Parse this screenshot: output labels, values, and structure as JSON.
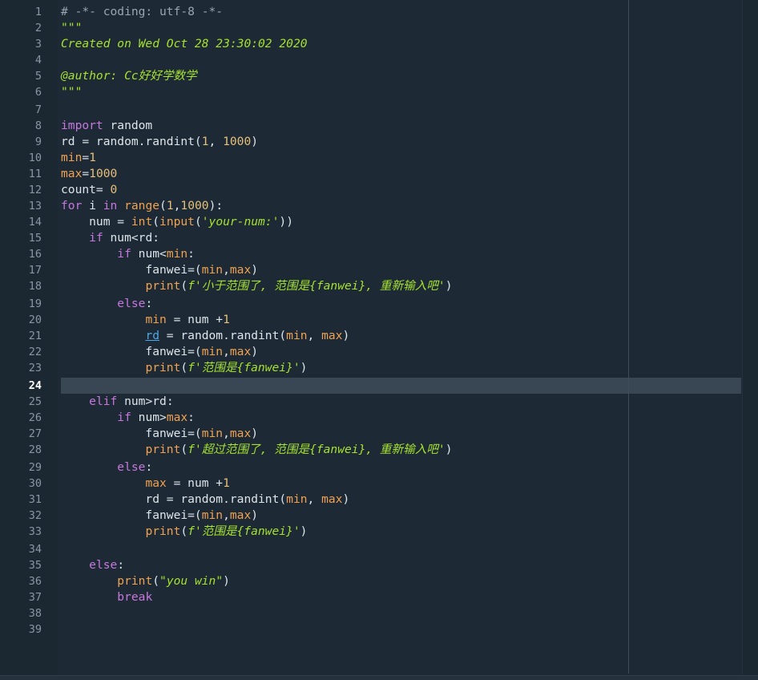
{
  "editor": {
    "active_line": 24,
    "line_numbers": [
      "1",
      "2",
      "3",
      "4",
      "5",
      "6",
      "7",
      "8",
      "9",
      "10",
      "11",
      "12",
      "13",
      "14",
      "15",
      "16",
      "17",
      "18",
      "19",
      "20",
      "21",
      "22",
      "23",
      "24",
      "25",
      "26",
      "27",
      "28",
      "29",
      "30",
      "31",
      "32",
      "33",
      "34",
      "35",
      "36",
      "37",
      "38",
      "39"
    ],
    "colors": {
      "background": "#1d2935",
      "gutter": "#1b2731",
      "current_line": "#384753",
      "keyword": "#c678dd",
      "number": "#e5c07b",
      "builtin": "#f0a250",
      "string": "#a6e22e",
      "comment": "#9aa5b0",
      "text": "#dde4ea",
      "link": "#4ea9e9"
    },
    "lines": {
      "l1": [
        {
          "t": "# -*- coding: utf-8 -*-",
          "c": "cmt"
        }
      ],
      "l2": [
        {
          "t": "\"\"\"",
          "c": "doc"
        }
      ],
      "l3": [
        {
          "t": "Created on Wed Oct 28 23:30:02 2020",
          "c": "doc"
        }
      ],
      "l4": [],
      "l5": [
        {
          "t": "@author: Cc好好学数学",
          "c": "doc"
        }
      ],
      "l6": [
        {
          "t": "\"\"\"",
          "c": "doc"
        }
      ],
      "l7": [],
      "l8": [
        {
          "t": "import",
          "c": "kw"
        },
        {
          "t": " random",
          "c": "plain"
        }
      ],
      "l9": [
        {
          "t": "rd = random.randint(",
          "c": "plain"
        },
        {
          "t": "1",
          "c": "num"
        },
        {
          "t": ", ",
          "c": "plain"
        },
        {
          "t": "1000",
          "c": "num"
        },
        {
          "t": ")",
          "c": "plain"
        }
      ],
      "l10": [
        {
          "t": "min",
          "c": "bi"
        },
        {
          "t": "=",
          "c": "plain"
        },
        {
          "t": "1",
          "c": "num"
        }
      ],
      "l11": [
        {
          "t": "max",
          "c": "bi"
        },
        {
          "t": "=",
          "c": "plain"
        },
        {
          "t": "1000",
          "c": "num"
        }
      ],
      "l12": [
        {
          "t": "count= ",
          "c": "plain"
        },
        {
          "t": "0",
          "c": "num"
        }
      ],
      "l13": [
        {
          "t": "for",
          "c": "kw"
        },
        {
          "t": " i ",
          "c": "plain"
        },
        {
          "t": "in",
          "c": "kw"
        },
        {
          "t": " ",
          "c": "plain"
        },
        {
          "t": "range",
          "c": "bi"
        },
        {
          "t": "(",
          "c": "plain"
        },
        {
          "t": "1",
          "c": "num"
        },
        {
          "t": ",",
          "c": "plain"
        },
        {
          "t": "1000",
          "c": "num"
        },
        {
          "t": "):",
          "c": "plain"
        }
      ],
      "l14": [
        {
          "t": "    num = ",
          "c": "plain"
        },
        {
          "t": "int",
          "c": "bi"
        },
        {
          "t": "(",
          "c": "plain"
        },
        {
          "t": "input",
          "c": "bi"
        },
        {
          "t": "(",
          "c": "plain"
        },
        {
          "t": "'your-num:'",
          "c": "str"
        },
        {
          "t": "))",
          "c": "plain"
        }
      ],
      "l15": [
        {
          "t": "    ",
          "c": "plain"
        },
        {
          "t": "if",
          "c": "kw"
        },
        {
          "t": " num<rd:",
          "c": "plain"
        }
      ],
      "l16": [
        {
          "t": "        ",
          "c": "plain"
        },
        {
          "t": "if",
          "c": "kw"
        },
        {
          "t": " num<",
          "c": "plain"
        },
        {
          "t": "min",
          "c": "bi"
        },
        {
          "t": ":",
          "c": "plain"
        }
      ],
      "l17": [
        {
          "t": "            fanwei=(",
          "c": "plain"
        },
        {
          "t": "min",
          "c": "bi"
        },
        {
          "t": ",",
          "c": "plain"
        },
        {
          "t": "max",
          "c": "bi"
        },
        {
          "t": ")",
          "c": "plain"
        }
      ],
      "l18": [
        {
          "t": "            ",
          "c": "plain"
        },
        {
          "t": "print",
          "c": "bi"
        },
        {
          "t": "(",
          "c": "plain"
        },
        {
          "t": "f'小于范围了, 范围是{fanwei}, 重新输入吧'",
          "c": "str"
        },
        {
          "t": ")",
          "c": "plain"
        }
      ],
      "l19": [
        {
          "t": "        ",
          "c": "plain"
        },
        {
          "t": "else",
          "c": "kw"
        },
        {
          "t": ":",
          "c": "plain"
        }
      ],
      "l20": [
        {
          "t": "            ",
          "c": "plain"
        },
        {
          "t": "min",
          "c": "bi"
        },
        {
          "t": " = num +",
          "c": "plain"
        },
        {
          "t": "1",
          "c": "num"
        }
      ],
      "l21": [
        {
          "t": "            ",
          "c": "plain"
        },
        {
          "t": "rd",
          "c": "link"
        },
        {
          "t": " = random.randint(",
          "c": "plain"
        },
        {
          "t": "min",
          "c": "bi"
        },
        {
          "t": ", ",
          "c": "plain"
        },
        {
          "t": "max",
          "c": "bi"
        },
        {
          "t": ")",
          "c": "plain"
        }
      ],
      "l22": [
        {
          "t": "            fanwei=(",
          "c": "plain"
        },
        {
          "t": "min",
          "c": "bi"
        },
        {
          "t": ",",
          "c": "plain"
        },
        {
          "t": "max",
          "c": "bi"
        },
        {
          "t": ")",
          "c": "plain"
        }
      ],
      "l23": [
        {
          "t": "            ",
          "c": "plain"
        },
        {
          "t": "print",
          "c": "bi"
        },
        {
          "t": "(",
          "c": "plain"
        },
        {
          "t": "f'范围是{fanwei}'",
          "c": "str"
        },
        {
          "t": ")",
          "c": "plain"
        }
      ],
      "l24": [],
      "l25": [
        {
          "t": "    ",
          "c": "plain"
        },
        {
          "t": "elif",
          "c": "kw"
        },
        {
          "t": " num>rd:",
          "c": "plain"
        }
      ],
      "l26": [
        {
          "t": "        ",
          "c": "plain"
        },
        {
          "t": "if",
          "c": "kw"
        },
        {
          "t": " num>",
          "c": "plain"
        },
        {
          "t": "max",
          "c": "bi"
        },
        {
          "t": ":",
          "c": "plain"
        }
      ],
      "l27": [
        {
          "t": "            fanwei=(",
          "c": "plain"
        },
        {
          "t": "min",
          "c": "bi"
        },
        {
          "t": ",",
          "c": "plain"
        },
        {
          "t": "max",
          "c": "bi"
        },
        {
          "t": ")",
          "c": "plain"
        }
      ],
      "l28": [
        {
          "t": "            ",
          "c": "plain"
        },
        {
          "t": "print",
          "c": "bi"
        },
        {
          "t": "(",
          "c": "plain"
        },
        {
          "t": "f'超过范围了, 范围是{fanwei}, 重新输入吧'",
          "c": "str"
        },
        {
          "t": ")",
          "c": "plain"
        }
      ],
      "l29": [
        {
          "t": "        ",
          "c": "plain"
        },
        {
          "t": "else",
          "c": "kw"
        },
        {
          "t": ":",
          "c": "plain"
        }
      ],
      "l30": [
        {
          "t": "            ",
          "c": "plain"
        },
        {
          "t": "max",
          "c": "bi"
        },
        {
          "t": " = num +",
          "c": "plain"
        },
        {
          "t": "1",
          "c": "num"
        }
      ],
      "l31": [
        {
          "t": "            rd = random.randint(",
          "c": "plain"
        },
        {
          "t": "min",
          "c": "bi"
        },
        {
          "t": ", ",
          "c": "plain"
        },
        {
          "t": "max",
          "c": "bi"
        },
        {
          "t": ")",
          "c": "plain"
        }
      ],
      "l32": [
        {
          "t": "            fanwei=(",
          "c": "plain"
        },
        {
          "t": "min",
          "c": "bi"
        },
        {
          "t": ",",
          "c": "plain"
        },
        {
          "t": "max",
          "c": "bi"
        },
        {
          "t": ")",
          "c": "plain"
        }
      ],
      "l33": [
        {
          "t": "            ",
          "c": "plain"
        },
        {
          "t": "print",
          "c": "bi"
        },
        {
          "t": "(",
          "c": "plain"
        },
        {
          "t": "f'范围是{fanwei}'",
          "c": "str"
        },
        {
          "t": ")",
          "c": "plain"
        }
      ],
      "l34": [],
      "l35": [
        {
          "t": "    ",
          "c": "plain"
        },
        {
          "t": "else",
          "c": "kw"
        },
        {
          "t": ":",
          "c": "plain"
        }
      ],
      "l36": [
        {
          "t": "        ",
          "c": "plain"
        },
        {
          "t": "print",
          "c": "bi"
        },
        {
          "t": "(",
          "c": "plain"
        },
        {
          "t": "\"you win\"",
          "c": "str"
        },
        {
          "t": ")",
          "c": "plain"
        }
      ],
      "l37": [
        {
          "t": "        ",
          "c": "plain"
        },
        {
          "t": "break",
          "c": "kw"
        }
      ],
      "l38": [],
      "l39": []
    }
  }
}
